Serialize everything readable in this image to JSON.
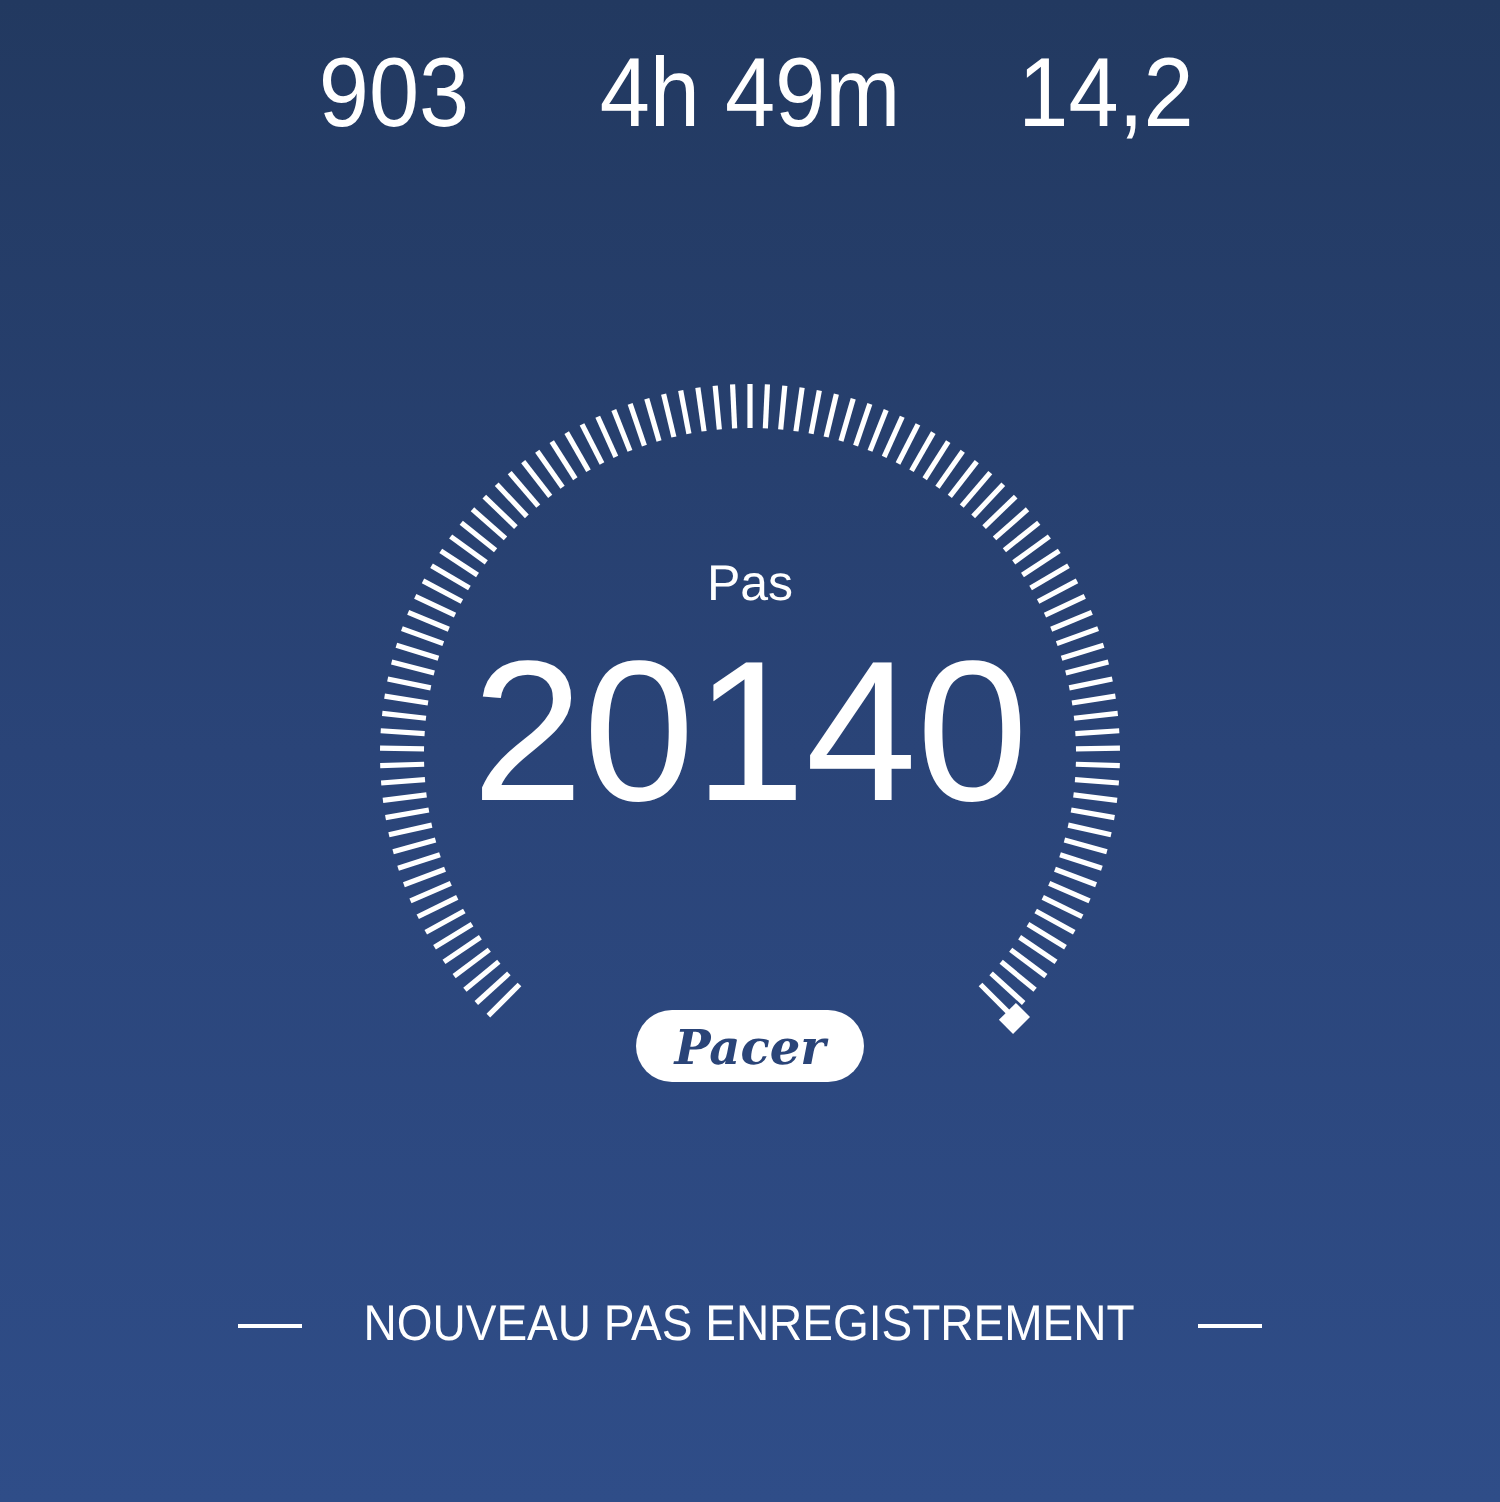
{
  "stats": [
    {
      "value": "903"
    },
    {
      "value": "4h 49m"
    },
    {
      "value": "14,2"
    }
  ],
  "gauge": {
    "label": "Pas",
    "value": "20140"
  },
  "logo": "Pacer",
  "footer": "NOUVEAU PAS ENREGISTREMENT"
}
